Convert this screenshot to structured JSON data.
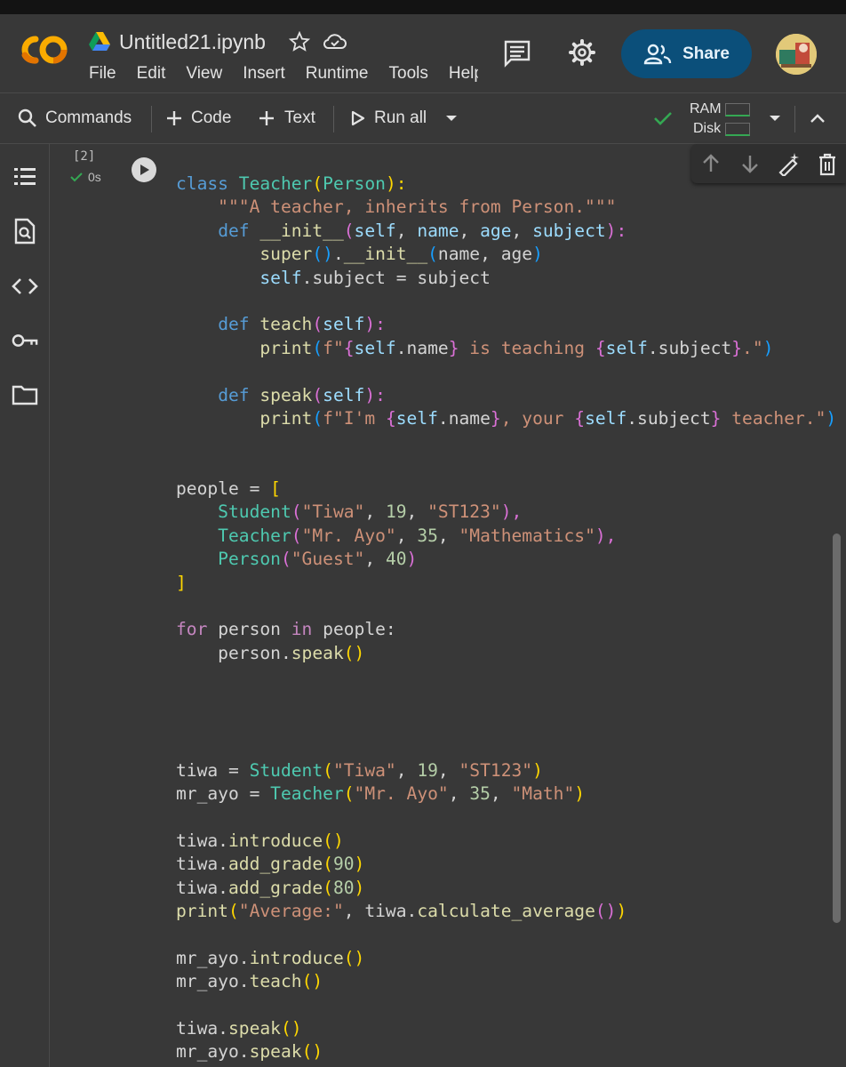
{
  "header": {
    "title": "Untitled21.ipynb",
    "menu": [
      "File",
      "Edit",
      "View",
      "Insert",
      "Runtime",
      "Tools",
      "Help"
    ],
    "share_label": "Share"
  },
  "toolbar": {
    "commands_label": "Commands",
    "code_label": "Code",
    "text_label": "Text",
    "run_all_label": "Run all",
    "ram_label": "RAM",
    "disk_label": "Disk"
  },
  "sidebar": {
    "icons": [
      "table-of-contents-icon",
      "find-replace-icon",
      "code-snippets-icon",
      "secrets-key-icon",
      "files-folder-icon"
    ]
  },
  "cell": {
    "exec_count": "[2]",
    "exec_time": "0s",
    "code_lines": [
      [
        [
          "class ",
          "kw"
        ],
        [
          "Teacher",
          "cls"
        ],
        [
          "(",
          "p1"
        ],
        [
          "Person",
          "cls"
        ],
        [
          "):",
          "p1"
        ]
      ],
      [
        [
          "    \"\"\"A teacher, inherits from Person.\"\"\"",
          "str"
        ]
      ],
      [
        [
          "    "
        ],
        [
          "def ",
          "kw"
        ],
        [
          "__init__",
          "fn"
        ],
        [
          "(",
          "p2"
        ],
        [
          "self",
          "self"
        ],
        [
          ", "
        ],
        [
          "name",
          "self"
        ],
        [
          ", "
        ],
        [
          "age",
          "self"
        ],
        [
          ", "
        ],
        [
          "subject",
          "self"
        ],
        [
          "):",
          "p2"
        ]
      ],
      [
        [
          "        super",
          "fn"
        ],
        [
          "()",
          "p3"
        ],
        [
          "."
        ],
        [
          "__init__",
          "fn"
        ],
        [
          "(",
          "p3"
        ],
        [
          "name, age"
        ],
        [
          ")",
          "p3"
        ]
      ],
      [
        [
          "        "
        ],
        [
          "self",
          "self"
        ],
        [
          ".subject = subject"
        ]
      ],
      [
        [
          ""
        ]
      ],
      [
        [
          "    "
        ],
        [
          "def ",
          "kw"
        ],
        [
          "teach",
          "fn"
        ],
        [
          "(",
          "p2"
        ],
        [
          "self",
          "self"
        ],
        [
          "):",
          "p2"
        ]
      ],
      [
        [
          "        print",
          "fn"
        ],
        [
          "(",
          "p3"
        ],
        [
          "f\"",
          "str"
        ],
        [
          "{",
          "p2"
        ],
        [
          "self",
          "self"
        ],
        [
          ".name"
        ],
        [
          "}",
          "p2"
        ],
        [
          " is teaching ",
          "str"
        ],
        [
          "{",
          "p2"
        ],
        [
          "self",
          "self"
        ],
        [
          ".subject"
        ],
        [
          "}",
          "p2"
        ],
        [
          ".\"",
          "str"
        ],
        [
          ")",
          "p3"
        ]
      ],
      [
        [
          ""
        ]
      ],
      [
        [
          "    "
        ],
        [
          "def ",
          "kw"
        ],
        [
          "speak",
          "fn"
        ],
        [
          "(",
          "p2"
        ],
        [
          "self",
          "self"
        ],
        [
          "):",
          "p2"
        ]
      ],
      [
        [
          "        print",
          "fn"
        ],
        [
          "(",
          "p3"
        ],
        [
          "f\"I'm ",
          "str"
        ],
        [
          "{",
          "p2"
        ],
        [
          "self",
          "self"
        ],
        [
          ".name"
        ],
        [
          "}",
          "p2"
        ],
        [
          ", your ",
          "str"
        ],
        [
          "{",
          "p2"
        ],
        [
          "self",
          "self"
        ],
        [
          ".subject"
        ],
        [
          "}",
          "p2"
        ],
        [
          " teacher.\"",
          "str"
        ],
        [
          ")",
          "p3"
        ]
      ],
      [
        [
          ""
        ]
      ],
      [
        [
          ""
        ]
      ],
      [
        [
          "people = "
        ],
        [
          "[",
          "p1"
        ]
      ],
      [
        [
          "    Student",
          "cls"
        ],
        [
          "(",
          "p2"
        ],
        [
          "\"Tiwa\"",
          "str"
        ],
        [
          ", "
        ],
        [
          "19",
          "num"
        ],
        [
          ", "
        ],
        [
          "\"ST123\"",
          "str"
        ],
        [
          "),",
          "p2"
        ]
      ],
      [
        [
          "    Teacher",
          "cls"
        ],
        [
          "(",
          "p2"
        ],
        [
          "\"Mr. Ayo\"",
          "str"
        ],
        [
          ", "
        ],
        [
          "35",
          "num"
        ],
        [
          ", "
        ],
        [
          "\"Mathematics\"",
          "str"
        ],
        [
          "),",
          "p2"
        ]
      ],
      [
        [
          "    Person",
          "cls"
        ],
        [
          "(",
          "p2"
        ],
        [
          "\"Guest\"",
          "str"
        ],
        [
          ", "
        ],
        [
          "40",
          "num"
        ],
        [
          ")",
          "p2"
        ]
      ],
      [
        [
          "]",
          "p1"
        ]
      ],
      [
        [
          ""
        ]
      ],
      [
        [
          "for ",
          "kw2"
        ],
        [
          "person "
        ],
        [
          "in ",
          "kw2"
        ],
        [
          "people:"
        ]
      ],
      [
        [
          "    person."
        ],
        [
          "speak",
          "fn"
        ],
        [
          "()",
          "p1"
        ]
      ],
      [
        [
          ""
        ]
      ],
      [
        [
          ""
        ]
      ],
      [
        [
          ""
        ]
      ],
      [
        [
          ""
        ]
      ],
      [
        [
          "tiwa = "
        ],
        [
          "Student",
          "cls"
        ],
        [
          "(",
          "p1"
        ],
        [
          "\"Tiwa\"",
          "str"
        ],
        [
          ", "
        ],
        [
          "19",
          "num"
        ],
        [
          ", "
        ],
        [
          "\"ST123\"",
          "str"
        ],
        [
          ")",
          "p1"
        ]
      ],
      [
        [
          "mr_ayo = "
        ],
        [
          "Teacher",
          "cls"
        ],
        [
          "(",
          "p1"
        ],
        [
          "\"Mr. Ayo\"",
          "str"
        ],
        [
          ", "
        ],
        [
          "35",
          "num"
        ],
        [
          ", "
        ],
        [
          "\"Math\"",
          "str"
        ],
        [
          ")",
          "p1"
        ]
      ],
      [
        [
          ""
        ]
      ],
      [
        [
          "tiwa."
        ],
        [
          "introduce",
          "fn"
        ],
        [
          "()",
          "p1"
        ]
      ],
      [
        [
          "tiwa."
        ],
        [
          "add_grade",
          "fn"
        ],
        [
          "(",
          "p1"
        ],
        [
          "90",
          "num"
        ],
        [
          ")",
          "p1"
        ]
      ],
      [
        [
          "tiwa."
        ],
        [
          "add_grade",
          "fn"
        ],
        [
          "(",
          "p1"
        ],
        [
          "80",
          "num"
        ],
        [
          ")",
          "p1"
        ]
      ],
      [
        [
          "print",
          "fn"
        ],
        [
          "(",
          "p1"
        ],
        [
          "\"Average:\"",
          "str"
        ],
        [
          ", tiwa."
        ],
        [
          "calculate_average",
          "fn"
        ],
        [
          "(",
          "p2"
        ],
        [
          ")",
          "p2"
        ],
        [
          ")",
          "p1"
        ]
      ],
      [
        [
          ""
        ]
      ],
      [
        [
          "mr_ayo."
        ],
        [
          "introduce",
          "fn"
        ],
        [
          "()",
          "p1"
        ]
      ],
      [
        [
          "mr_ayo."
        ],
        [
          "teach",
          "fn"
        ],
        [
          "()",
          "p1"
        ]
      ],
      [
        [
          ""
        ]
      ],
      [
        [
          "tiwa."
        ],
        [
          "speak",
          "fn"
        ],
        [
          "()",
          "p1"
        ]
      ],
      [
        [
          "mr_ayo."
        ],
        [
          "speak",
          "fn"
        ],
        [
          "()",
          "p1"
        ]
      ]
    ]
  },
  "colors": {
    "background": "#383838",
    "share_bg": "#0b4f7a",
    "logo_orange": "#f9ab00",
    "check_green": "#34a853"
  }
}
